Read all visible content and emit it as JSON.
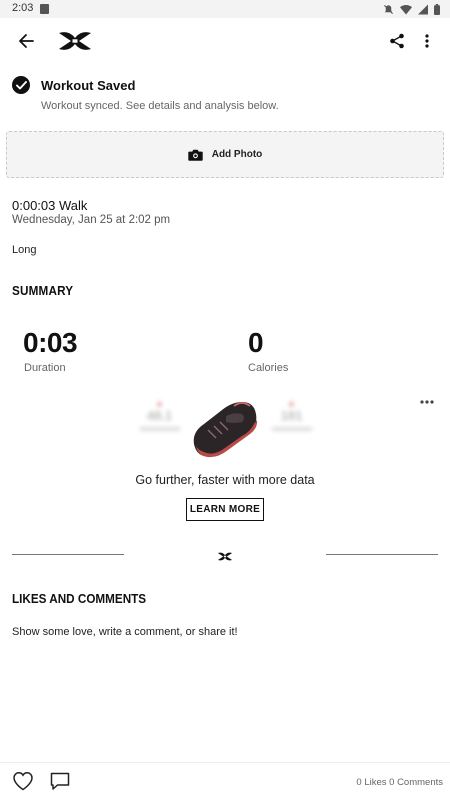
{
  "status_bar": {
    "time": "2:03"
  },
  "header": {
    "back_icon": "arrow-left-icon",
    "logo_icon": "under-armour-logo",
    "share_icon": "share-icon",
    "more_icon": "more-vertical-icon"
  },
  "saved": {
    "title": "Workout Saved",
    "subtitle": "Workout synced. See details and analysis below."
  },
  "add_photo": {
    "label": "Add Photo",
    "icon": "camera-icon"
  },
  "workout": {
    "title": "0:00:03 Walk",
    "date": "Wednesday, Jan 25 at 2:02 pm",
    "note": "Long"
  },
  "summary": {
    "heading": "SUMMARY",
    "stats": [
      {
        "value": "0:03",
        "label": "Duration"
      },
      {
        "value": "0",
        "label": "Calories"
      }
    ]
  },
  "promo": {
    "blur_left_value": "48.1",
    "blur_right_value": "181",
    "text": "Go further, faster with more data",
    "button": "LEARN MORE"
  },
  "likes": {
    "heading": "LIKES AND COMMENTS",
    "subtitle": "Show some love, write a comment, or share it!"
  },
  "bottom_bar": {
    "count_text": "0 Likes 0 Comments"
  },
  "colors": {
    "accent": "#111111",
    "shoe_sole": "#c0504d",
    "muted_text": "#666666"
  }
}
